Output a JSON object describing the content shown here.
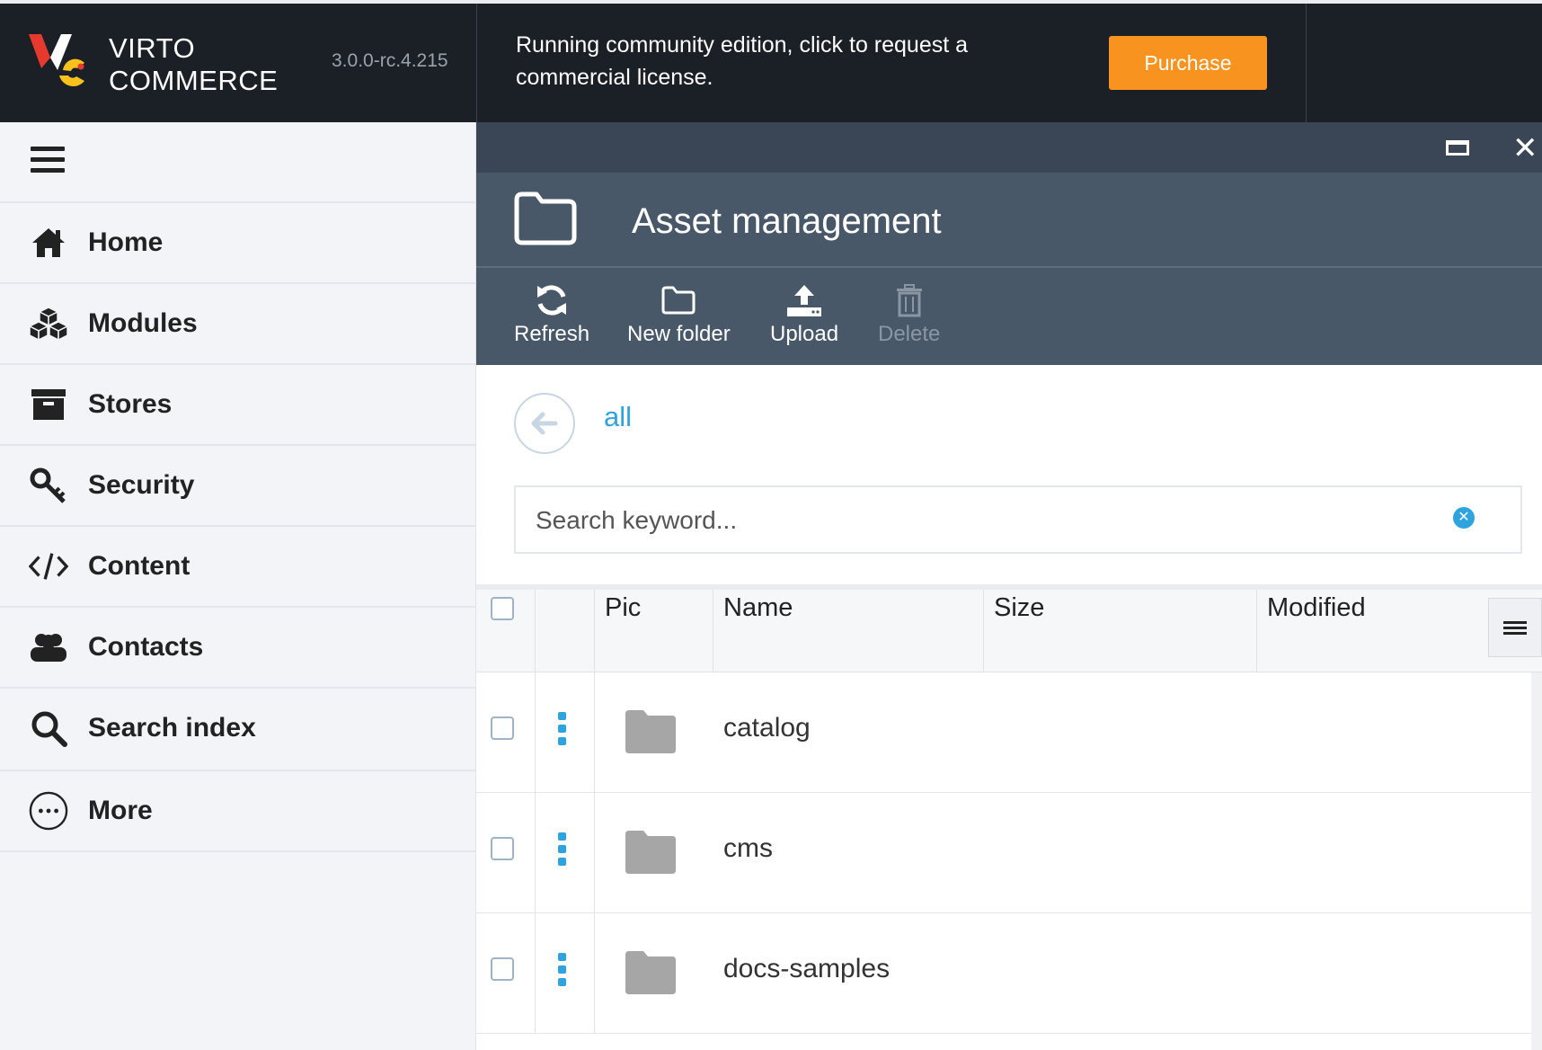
{
  "header": {
    "logo_line1": "VIRTO",
    "logo_line2": "COMMERCE",
    "version": "3.0.0-rc.4.215",
    "banner_text": "Running community edition, click to request a commercial license.",
    "purchase_label": "Purchase",
    "colors": {
      "dark": "#1b1f26",
      "accent": "#f7931e"
    }
  },
  "sidebar": {
    "menu_icon": "hamburger-icon",
    "items": [
      {
        "label": "Home",
        "icon": "home-icon"
      },
      {
        "label": "Modules",
        "icon": "cubes-icon"
      },
      {
        "label": "Stores",
        "icon": "archive-icon"
      },
      {
        "label": "Security",
        "icon": "key-icon"
      },
      {
        "label": "Content",
        "icon": "code-icon"
      },
      {
        "label": "Contacts",
        "icon": "users-icon"
      },
      {
        "label": "Search index",
        "icon": "search-icon"
      },
      {
        "label": "More",
        "icon": "more-icon"
      }
    ]
  },
  "blade": {
    "title": "Asset management",
    "icon": "folder-icon",
    "toolbar": [
      {
        "label": "Refresh",
        "icon": "refresh-icon",
        "enabled": true
      },
      {
        "label": "New folder",
        "icon": "folder-icon",
        "enabled": true
      },
      {
        "label": "Upload",
        "icon": "upload-icon",
        "enabled": true
      },
      {
        "label": "Delete",
        "icon": "trash-icon",
        "enabled": false
      }
    ],
    "breadcrumb": "all",
    "search": {
      "placeholder": "Search keyword...",
      "value": ""
    },
    "grid": {
      "columns": [
        "Pic",
        "Name",
        "Size",
        "Modified"
      ],
      "rows": [
        {
          "name": "catalog",
          "type": "folder",
          "size": "",
          "modified": ""
        },
        {
          "name": "cms",
          "type": "folder",
          "size": "",
          "modified": ""
        },
        {
          "name": "docs-samples",
          "type": "folder",
          "size": "",
          "modified": ""
        }
      ]
    }
  }
}
